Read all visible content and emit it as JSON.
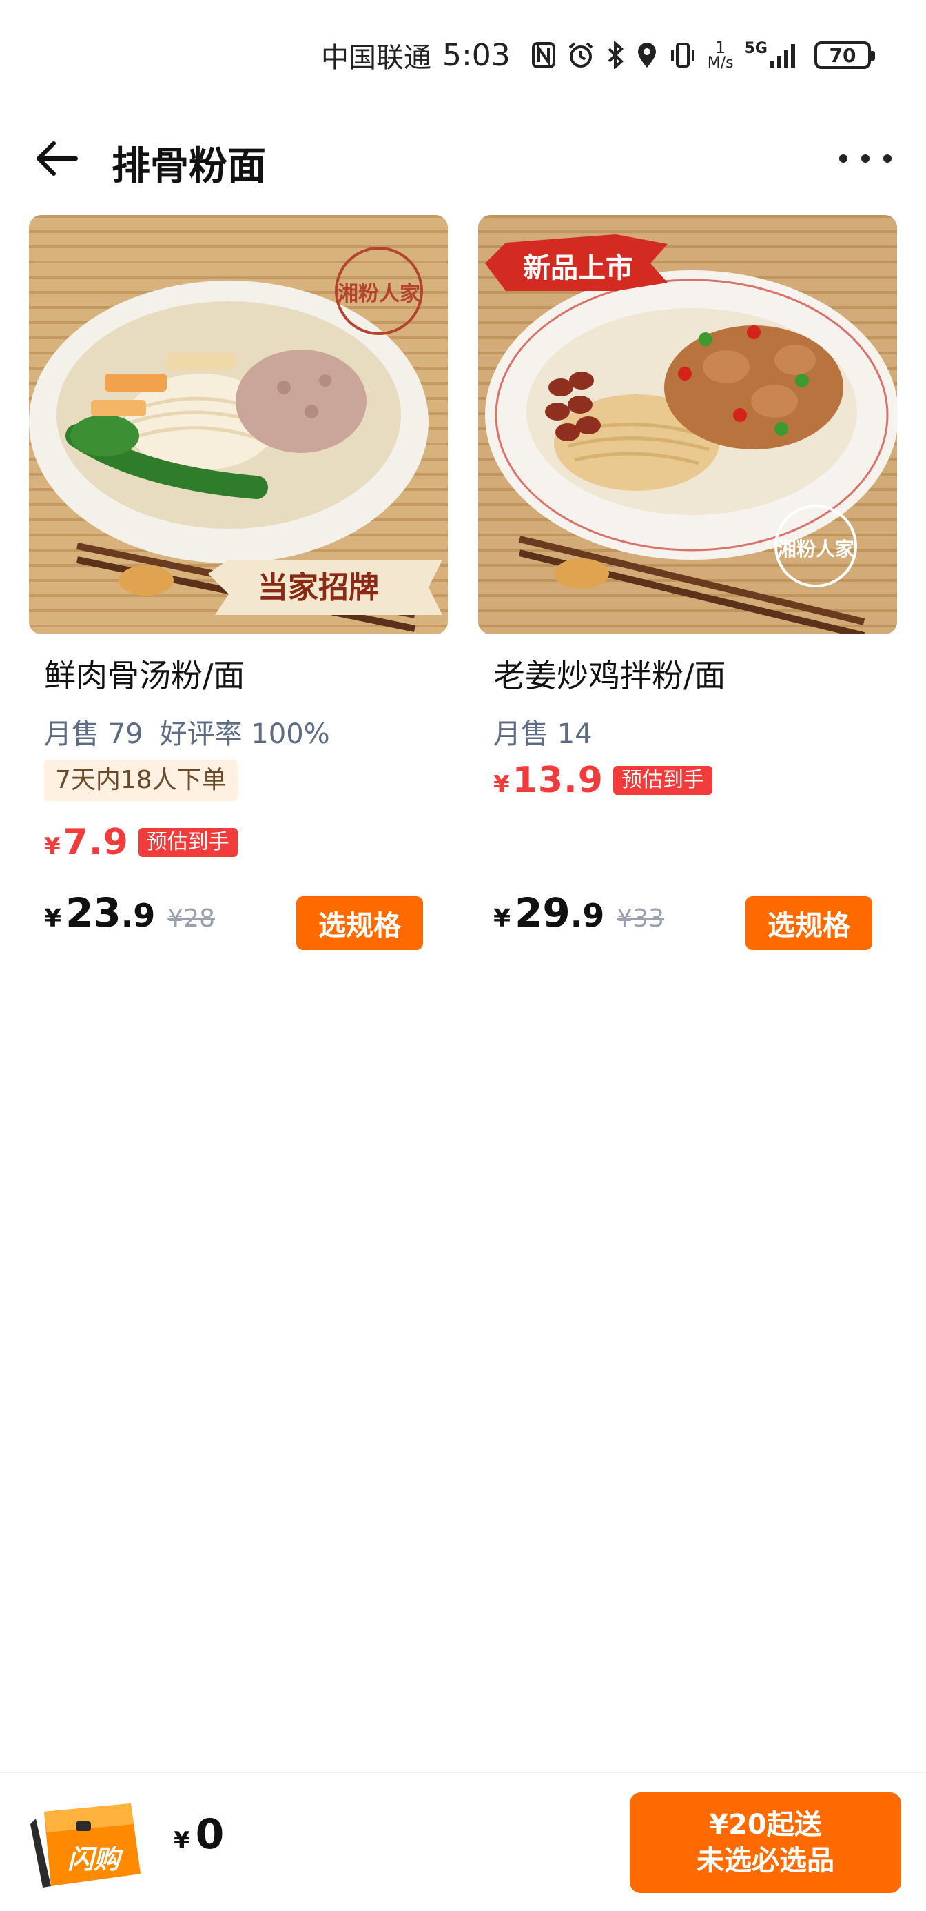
{
  "status_bar": {
    "carrier": "中国联通",
    "time": "5:03",
    "net_speed_value": "1",
    "net_speed_unit": "M/s",
    "signal_label": "5G",
    "battery": "70",
    "icons": [
      "nfc-icon",
      "alarm-icon",
      "bluetooth-icon",
      "location-icon",
      "vibrate-icon",
      "signal-icon",
      "battery-icon"
    ]
  },
  "header": {
    "title": "排骨粉面"
  },
  "products": [
    {
      "name": "鲜肉骨汤粉/面",
      "monthly_sales": "月售 79",
      "rating": "好评率 100%",
      "tag": "7天内18人下单",
      "est_currency": "¥",
      "est_price": "7.9",
      "est_label": "预估到手",
      "currency": "¥",
      "price_int": "23",
      "price_dec": ".9",
      "original_price": "¥28",
      "button": "选规格",
      "image_badge": "当家招牌",
      "logo_text": "湘粉人家"
    },
    {
      "name": "老姜炒鸡拌粉/面",
      "monthly_sales": "月售 14",
      "est_currency": "¥",
      "est_price": "13.9",
      "est_label": "预估到手",
      "currency": "¥",
      "price_int": "29",
      "price_dec": ".9",
      "original_price": "¥33",
      "button": "选规格",
      "image_badge": "新品上市",
      "logo_text": "湘粉人家"
    }
  ],
  "bottom_bar": {
    "cart_badge": "闪购",
    "currency": "¥",
    "total": "0",
    "checkout_line1": "¥20起送",
    "checkout_line2": "未选必选品"
  },
  "colors": {
    "accent_orange": "#ff6a00",
    "price_red": "#f23c3c",
    "muted_text": "#5e6b85"
  }
}
